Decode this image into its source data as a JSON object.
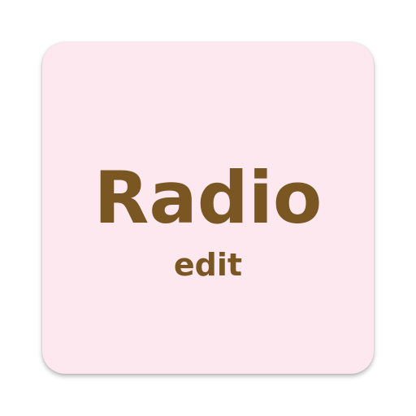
{
  "icon": {
    "title": "Radio",
    "subtitle": "edit"
  },
  "colors": {
    "tile_background": "#fce8ee",
    "text": "#7a5623"
  }
}
